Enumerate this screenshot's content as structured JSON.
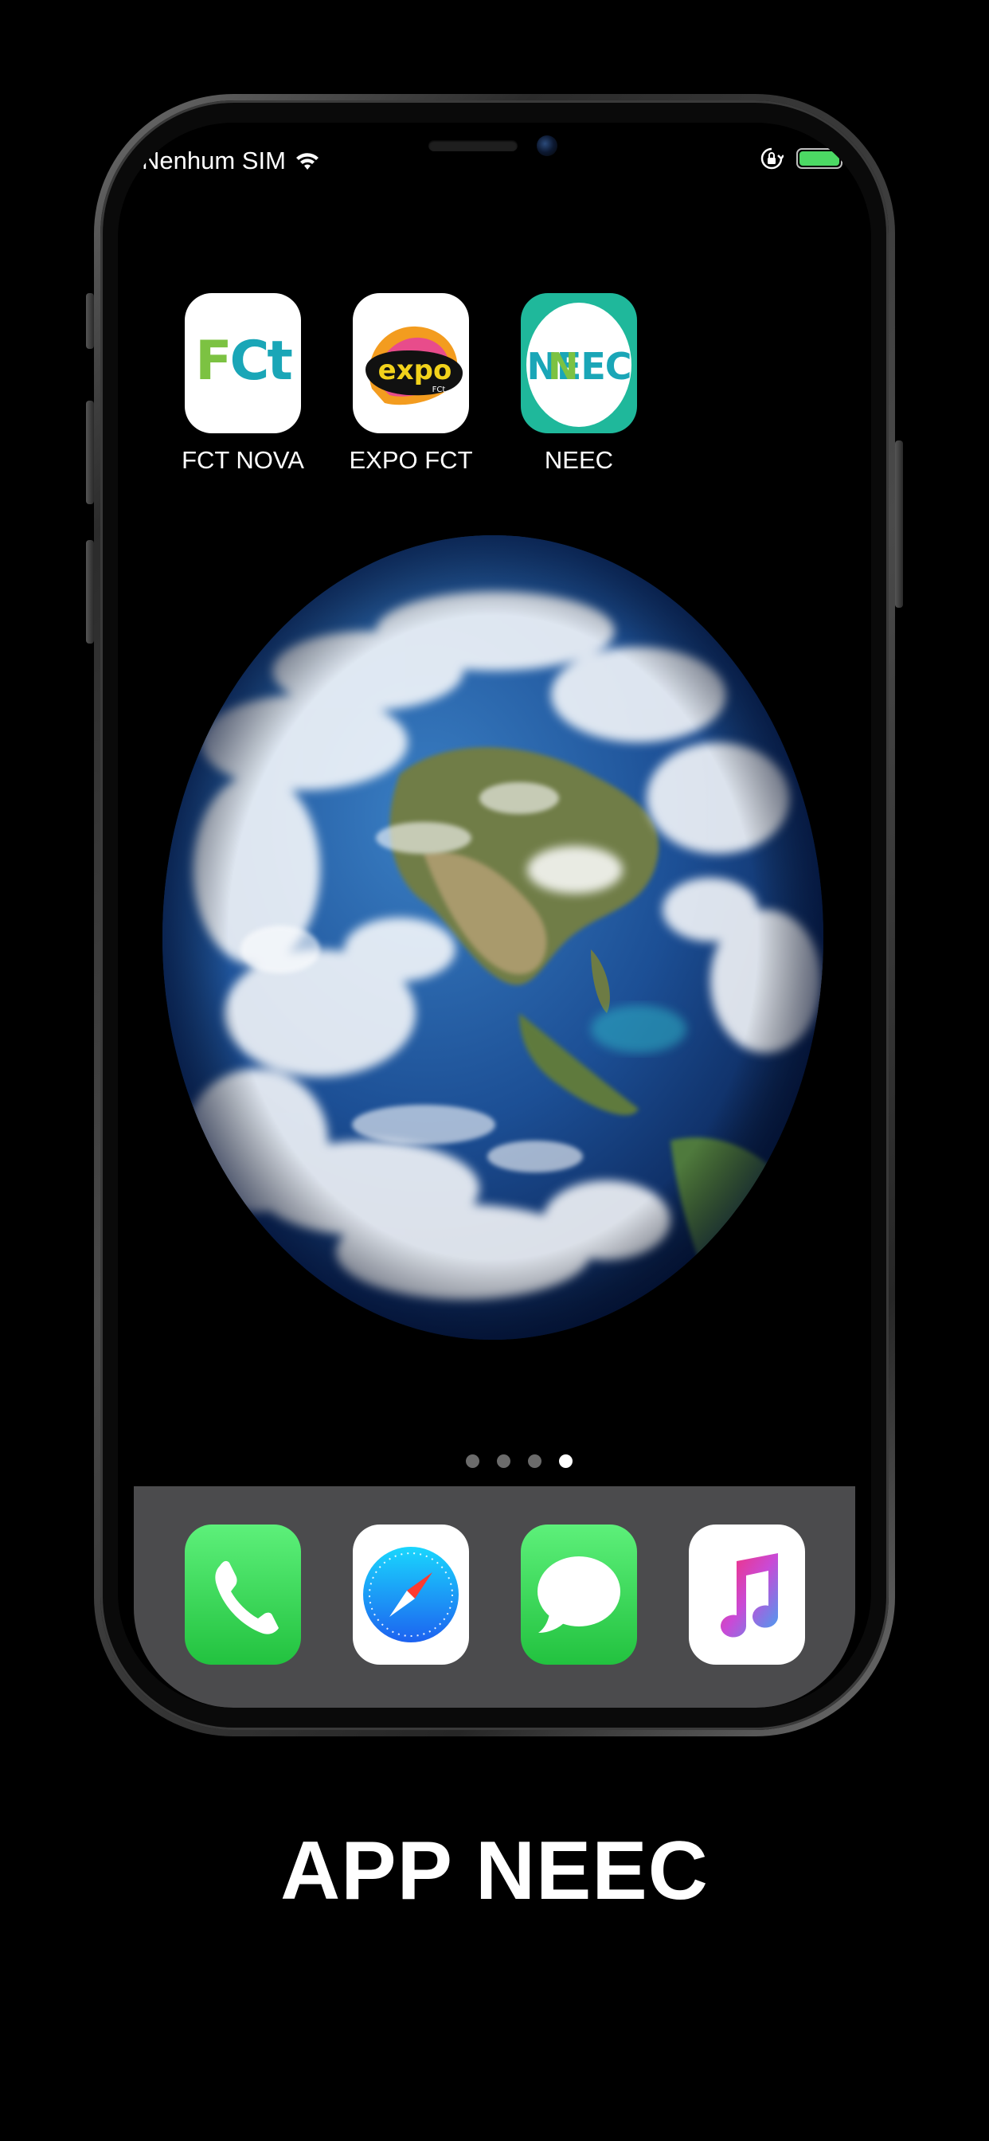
{
  "status_bar": {
    "carrier": "Nenhum SIM",
    "battery_level": 1.0
  },
  "home_apps": [
    {
      "label": "FCT NOVA",
      "icon": "fct-nova-icon"
    },
    {
      "label": "EXPO FCT",
      "icon": "expo-fct-icon",
      "badge_text": "expo",
      "badge_sub": "FCt"
    },
    {
      "label": "NEEC",
      "icon": "neec-icon",
      "badge_text": "NEEC"
    }
  ],
  "fct_logo_text": "FCt",
  "page_indicator": {
    "count": 4,
    "active_index": 3
  },
  "dock_apps": [
    {
      "name": "phone",
      "icon": "phone-icon"
    },
    {
      "name": "safari",
      "icon": "compass-icon"
    },
    {
      "name": "messages",
      "icon": "chat-bubble-icon"
    },
    {
      "name": "music",
      "icon": "music-note-icon"
    }
  ],
  "caption": "APP NEEC",
  "colors": {
    "background": "#000000",
    "dock": "#4b4b4d",
    "battery": "#4cd964",
    "neec_teal": "#1fb89b",
    "phone_green": "#34c759"
  }
}
